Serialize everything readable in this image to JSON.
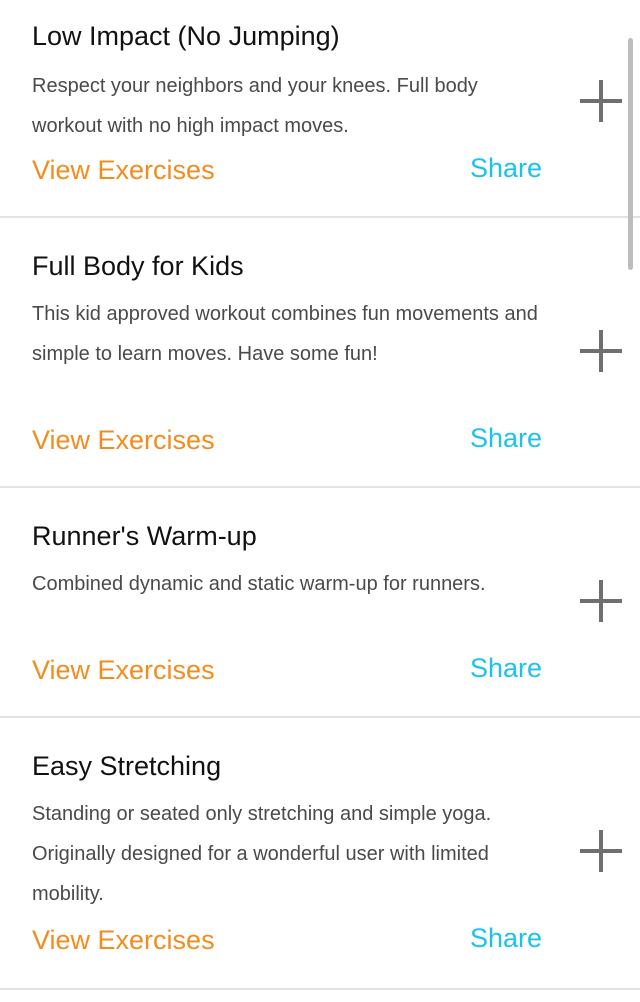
{
  "workouts": [
    {
      "title": "Low Impact (No Jumping)",
      "description": "Respect your neighbors and your knees. Full body workout with no high impact moves.",
      "view_label": "View Exercises",
      "share_label": "Share",
      "add_icon": "plus-icon"
    },
    {
      "title": "Full Body for Kids",
      "description": "This kid approved workout combines fun movements and simple to learn moves. Have some fun!",
      "view_label": "View Exercises",
      "share_label": "Share",
      "add_icon": "plus-icon"
    },
    {
      "title": "Runner's Warm-up",
      "description": "Combined dynamic and static warm-up for runners.",
      "view_label": "View Exercises",
      "share_label": "Share",
      "add_icon": "plus-icon"
    },
    {
      "title": "Easy Stretching",
      "description": "Standing or seated only stretching and simple yoga. Originally designed for a wonderful user with limited mobility.",
      "view_label": "View Exercises",
      "share_label": "Share",
      "add_icon": "plus-icon"
    }
  ],
  "colors": {
    "view_link": "#f28c1c",
    "share_link": "#1ac3ef",
    "plus_icon": "#6f6f6f",
    "divider": "#e2e2e2"
  }
}
